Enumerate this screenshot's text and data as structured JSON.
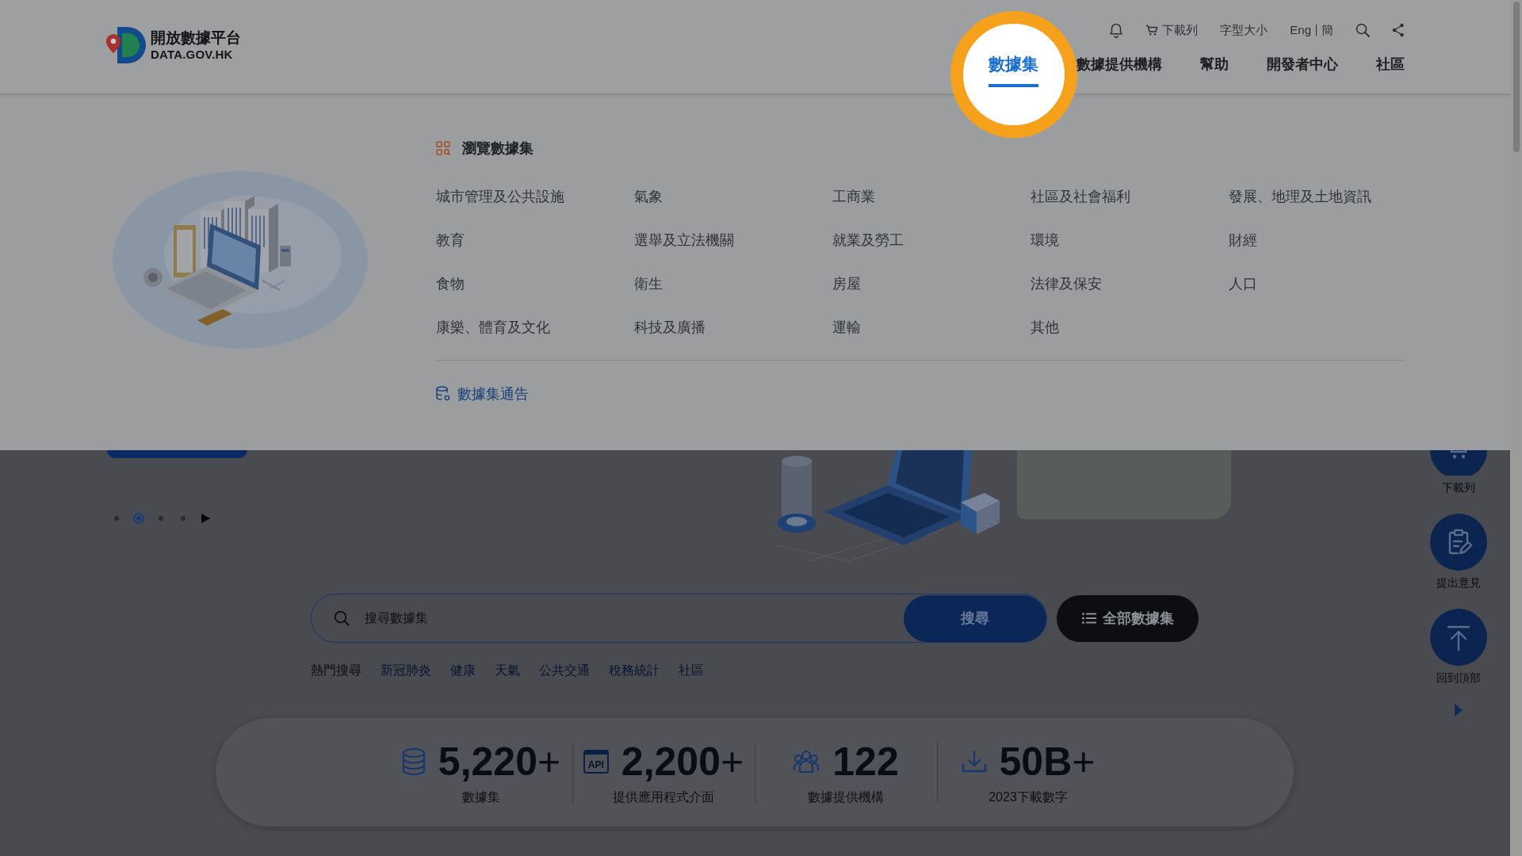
{
  "header": {
    "logo": {
      "title": "開放數據平台",
      "subtitle": "DATA.GOV.HK"
    },
    "utility": {
      "download_list": "下載列",
      "font_size": "字型大小",
      "languages": [
        "Eng",
        "簡"
      ]
    },
    "nav": [
      {
        "label": "數據集",
        "selected": true,
        "spotlighted": true
      },
      {
        "label": "數據提供機構",
        "selected": false,
        "spotlighted": false
      },
      {
        "label": "幫助",
        "selected": false,
        "spotlighted": false
      },
      {
        "label": "開發者中心",
        "selected": false,
        "spotlighted": false
      },
      {
        "label": "社區",
        "selected": false,
        "spotlighted": false
      }
    ]
  },
  "mega_menu": {
    "heading": "瀏覽數據集",
    "categories": [
      "城市管理及公共設施",
      "氣象",
      "工商業",
      "社區及社會福利",
      "發展、地理及土地資訊",
      "教育",
      "選舉及立法機關",
      "就業及勞工",
      "環境",
      "財經",
      "食物",
      "衛生",
      "房屋",
      "法律及保安",
      "人口",
      "康樂、體育及文化",
      "科技及廣播",
      "運輸",
      "其他"
    ],
    "notice_link": "數據集通告"
  },
  "hero": {
    "slides": [
      {
        "selected": false
      },
      {
        "selected": true
      },
      {
        "selected": false
      },
      {
        "selected": false
      }
    ]
  },
  "search": {
    "placeholder": "搜尋數據集",
    "button": "搜尋",
    "all_button": "全部數據集",
    "hot_label": "熱門搜尋",
    "hot_terms": [
      "新冠肺炎",
      "健康",
      "天氣",
      "公共交通",
      "稅務統計",
      "社區"
    ]
  },
  "stats": [
    {
      "kind": "datasets",
      "value": "5,220",
      "suffix": "+",
      "label": "數據集"
    },
    {
      "kind": "api",
      "icon_text": "API",
      "value": "2,200",
      "suffix": "+",
      "label": "提供應用程式介面"
    },
    {
      "kind": "providers",
      "value": "122",
      "label": "數據提供機構"
    },
    {
      "kind": "downloads",
      "value": "50B",
      "suffix": "+",
      "label": "2023下載數字"
    }
  ],
  "side_buttons": [
    {
      "kind": "download_list",
      "label": "下載列"
    },
    {
      "kind": "feedback",
      "label": "提出意見"
    },
    {
      "kind": "back_to_top",
      "label": "回到頂部"
    }
  ]
}
